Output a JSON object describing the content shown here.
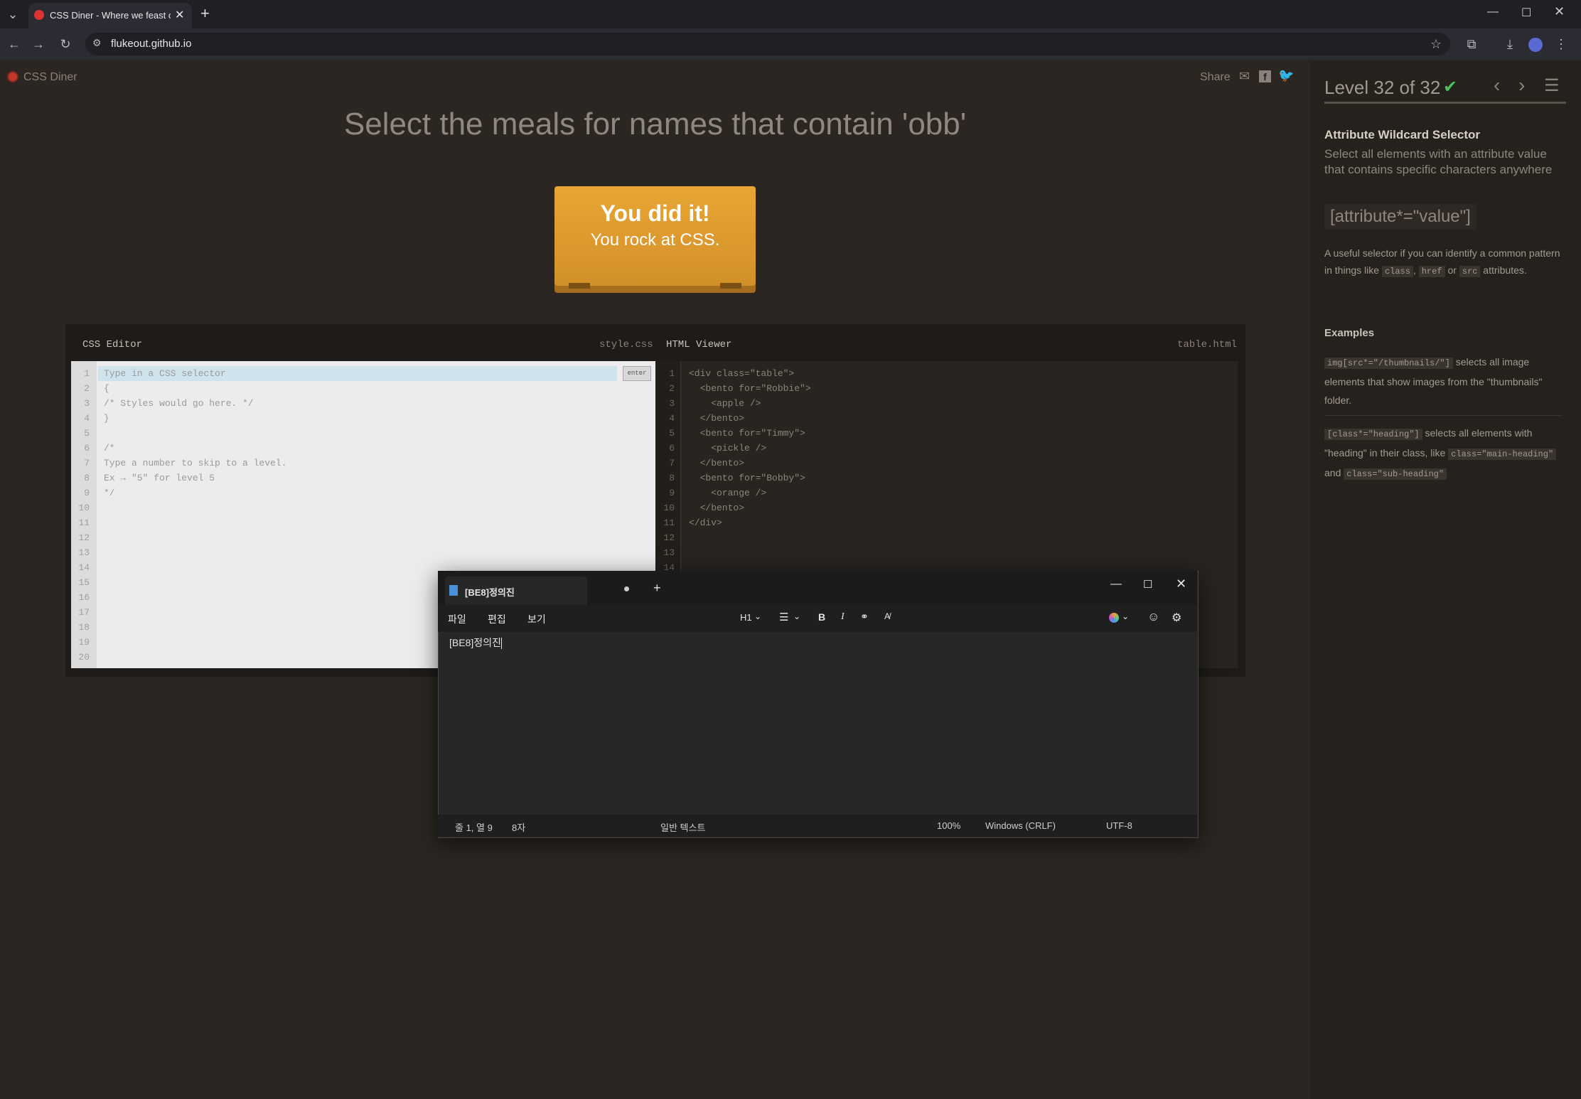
{
  "browser": {
    "tab_title": "CSS Diner - Where we feast on",
    "url": "flukeout.github.io",
    "new_tab": "+"
  },
  "site": {
    "logo": "CSS Diner",
    "share": "Share",
    "heading": "Select the meals for names that contain 'obb'",
    "plate_line1": "You did it!",
    "plate_line2": "You rock at CSS."
  },
  "editor": {
    "css_label": "CSS Editor",
    "css_file": "style.css",
    "html_label": "HTML Viewer",
    "html_file": "table.html",
    "enter_button": "enter",
    "css_lines": [
      "Type in a CSS selector",
      "{",
      "/* Styles would go here. */",
      "}",
      "",
      "/*",
      "Type a number to skip to a level.",
      "Ex → \"5\" for level 5",
      "*/",
      "",
      "",
      "",
      "",
      "",
      "",
      "",
      "",
      "",
      "",
      ""
    ],
    "html_lines": [
      "<div class=\"table\">",
      "  <bento for=\"Robbie\">",
      "    <apple />",
      "  </bento>",
      "  <bento for=\"Timmy\">",
      "    <pickle />",
      "  </bento>",
      "  <bento for=\"Bobby\">",
      "    <orange />",
      "  </bento>",
      "</div>",
      "",
      "",
      ""
    ]
  },
  "sidebar": {
    "level": "Level 32 of 32",
    "check": "✔",
    "selector_name": "Attribute Wildcard Selector",
    "selector_desc": "Select all elements with an attribute value that contains specific characters anywhere",
    "syntax": "[attribute*=\"value\"]",
    "hint_a": "A useful selector if you can identify a common pattern in things like",
    "hint_code1": "class",
    "hint_sep": ",",
    "hint_code2": "href",
    "hint_or": "or",
    "hint_code3": "src",
    "hint_end": "attributes.",
    "examples_title": "Examples",
    "ex1_code": "img[src*=\"/thumbnails/\"]",
    "ex1_text": "selects all image elements that show images from the \"thumbnails\" folder.",
    "ex2_code": "[class*=\"heading\"]",
    "ex2_text1": "selects all elements with \"heading\" in their class, like",
    "ex2_code2": "class=\"main-heading\"",
    "ex2_and": "and",
    "ex2_code3": "class=\"sub-heading\""
  },
  "notepad": {
    "tab_title": "[BE8]정의진",
    "menu_file": "파일",
    "menu_edit": "편집",
    "menu_view": "보기",
    "heading_sel": "H1",
    "content": "[BE8]정의진",
    "status_pos": "줄 1, 열 9",
    "status_chars": "8자",
    "status_format": "일반 텍스트",
    "status_zoom": "100%",
    "status_eol": "Windows (CRLF)",
    "status_enc": "UTF-8"
  }
}
